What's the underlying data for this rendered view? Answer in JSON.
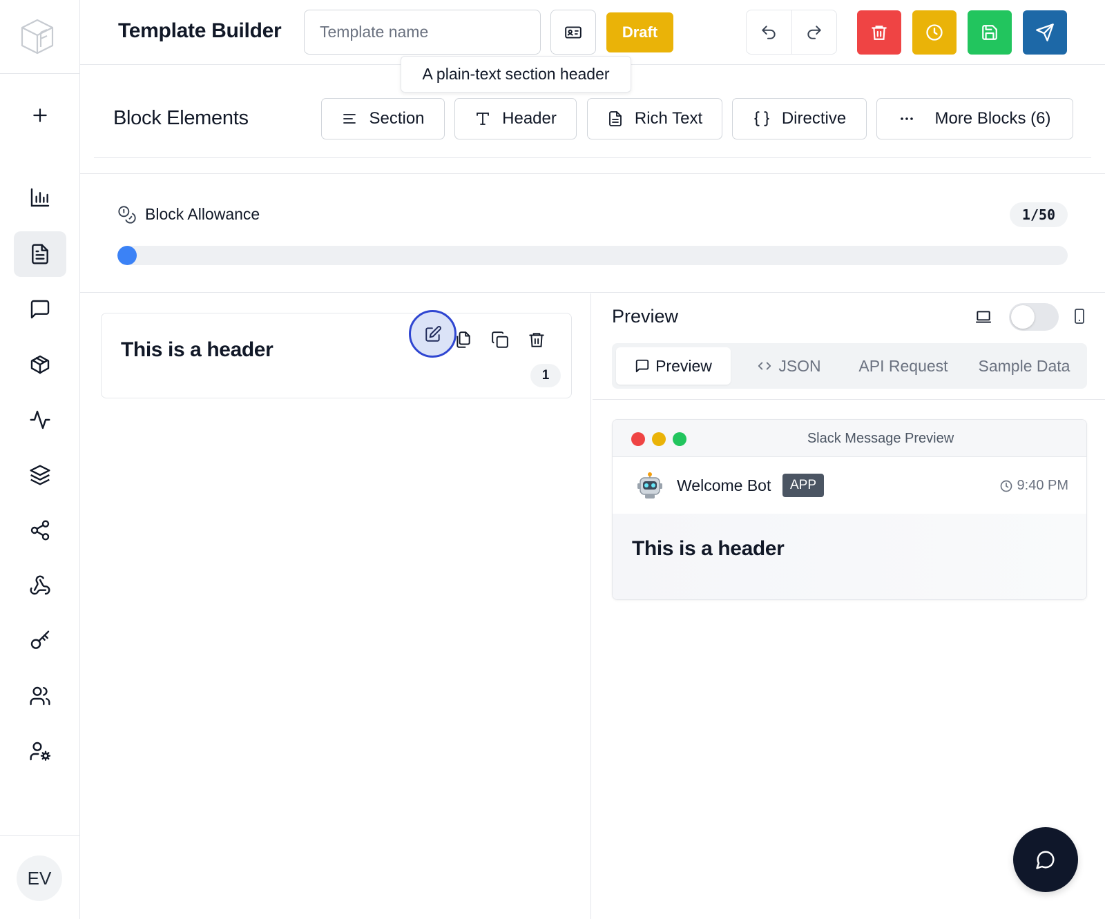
{
  "sidebar": {
    "logo_icon": "cube-logo-icon",
    "items": [
      {
        "name": "add",
        "icon": "plus-icon"
      },
      {
        "name": "analytics",
        "icon": "bar-chart-icon"
      },
      {
        "name": "templates",
        "icon": "document-icon",
        "active": true
      },
      {
        "name": "messages",
        "icon": "message-square-icon"
      },
      {
        "name": "packages",
        "icon": "package-icon"
      },
      {
        "name": "activity",
        "icon": "activity-icon"
      },
      {
        "name": "layers",
        "icon": "layers-icon"
      },
      {
        "name": "share",
        "icon": "share-icon"
      },
      {
        "name": "webhooks",
        "icon": "webhook-icon"
      },
      {
        "name": "keys",
        "icon": "key-icon"
      },
      {
        "name": "users",
        "icon": "users-icon"
      },
      {
        "name": "user-settings",
        "icon": "user-cog-icon"
      }
    ],
    "avatar_initials": "EV"
  },
  "header": {
    "title": "Template Builder",
    "template_name_value": "",
    "template_name_placeholder": "Template name",
    "status_badge": "Draft",
    "tooltip": "A plain-text section header",
    "colors": {
      "delete": "#ef4444",
      "schedule": "#eab308",
      "save": "#22c55e",
      "send": "#1d68a7",
      "draft": "#eab308"
    }
  },
  "block_elements": {
    "title": "Block Elements",
    "buttons": [
      {
        "label": "Section",
        "icon": "align-left-icon"
      },
      {
        "label": "Header",
        "icon": "type-icon"
      },
      {
        "label": "Rich Text",
        "icon": "file-text-icon"
      },
      {
        "label": "Directive",
        "icon": "braces-icon"
      },
      {
        "label": "More Blocks (6)",
        "icon": "ellipsis-icon"
      }
    ]
  },
  "allowance": {
    "label": "Block Allowance",
    "count": "1/50",
    "used": 1,
    "total": 50,
    "accent": "#3b82f6"
  },
  "editor": {
    "blocks": [
      {
        "title": "This is a header",
        "number": "1"
      }
    ]
  },
  "preview": {
    "title": "Preview",
    "tabs": [
      {
        "label": "Preview",
        "icon": "message-square-icon",
        "active": true
      },
      {
        "label": "JSON",
        "icon": "code-icon"
      },
      {
        "label": "API Request"
      },
      {
        "label": "Sample Data"
      }
    ],
    "slack": {
      "window_title": "Slack Message Preview",
      "bot_name": "Welcome Bot",
      "badge": "APP",
      "time": "9:40 PM",
      "header_text": "This is a header"
    }
  }
}
